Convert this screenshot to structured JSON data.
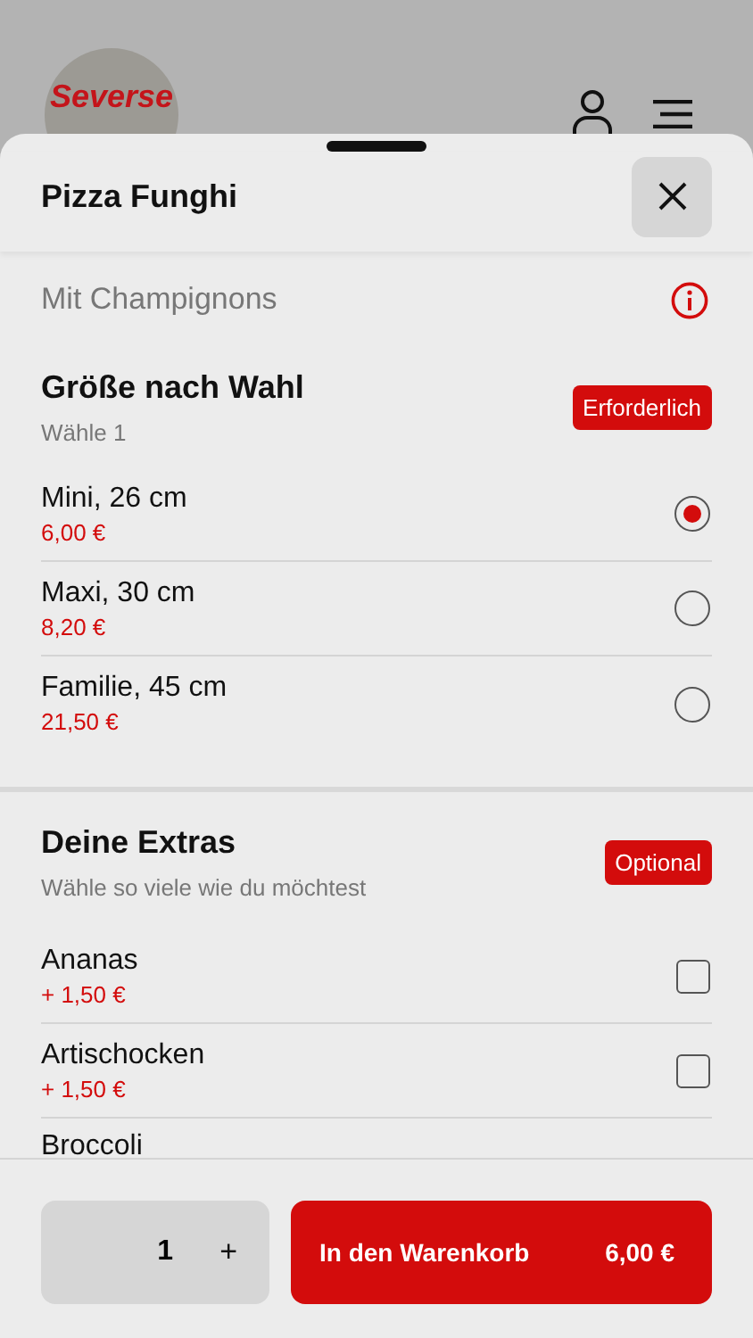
{
  "background": {
    "logo": "Severse"
  },
  "sheet": {
    "title": "Pizza Funghi",
    "description": "Mit Champignons"
  },
  "groups": [
    {
      "title": "Größe nach Wahl",
      "subtitle": "Wähle 1",
      "badge": "Erforderlich",
      "kind": "radio",
      "options": [
        {
          "name": "Mini, 26 cm",
          "price": "6,00 €",
          "selected": true
        },
        {
          "name": "Maxi, 30 cm",
          "price": "8,20 €",
          "selected": false
        },
        {
          "name": "Familie, 45 cm",
          "price": "21,50 €",
          "selected": false
        }
      ]
    },
    {
      "title": "Deine Extras",
      "subtitle": "Wähle so viele wie du möchtest",
      "badge": "Optional",
      "kind": "checkbox",
      "options": [
        {
          "name": "Ananas",
          "price": "+ 1,50 €",
          "checked": false
        },
        {
          "name": "Artischocken",
          "price": "+ 1,50 €",
          "checked": false
        },
        {
          "name": "Broccoli"
        }
      ]
    }
  ],
  "footer": {
    "quantity": "1",
    "plus": "+",
    "cart_label": "In den Warenkorb",
    "cart_price": "6,00 €"
  }
}
